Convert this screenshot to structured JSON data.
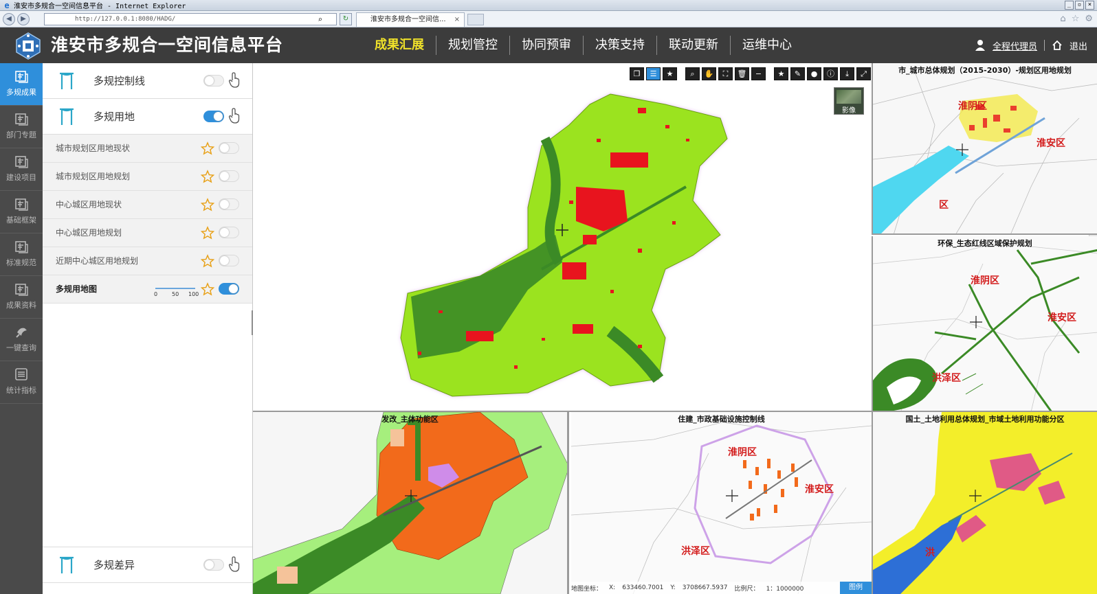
{
  "browser": {
    "window_title": "淮安市多规合一空间信息平台 - Internet Explorer",
    "url": "http://127.0.0.1:8080/HADG/",
    "tab_title": "淮安市多规合一空间信..."
  },
  "header": {
    "title": "淮安市多规合一空间信息平台",
    "nav": [
      {
        "label": "成果汇展",
        "active": true
      },
      {
        "label": "规划管控",
        "active": false
      },
      {
        "label": "协同预审",
        "active": false
      },
      {
        "label": "决策支持",
        "active": false
      },
      {
        "label": "联动更新",
        "active": false
      },
      {
        "label": "运维中心",
        "active": false
      }
    ],
    "user_name": "全程代理员",
    "logout_label": "退出",
    "accent_color": "#f0e22a",
    "bar_color": "#3c3c3c"
  },
  "rail": [
    {
      "label": "多规成果",
      "icon": "layers-icon",
      "active": true
    },
    {
      "label": "部门专题",
      "icon": "layers-icon",
      "active": false
    },
    {
      "label": "建设项目",
      "icon": "layers-icon",
      "active": false
    },
    {
      "label": "基础框架",
      "icon": "layers-icon",
      "active": false
    },
    {
      "label": "标准规范",
      "icon": "layers-icon",
      "active": false
    },
    {
      "label": "成果资料",
      "icon": "layers-icon",
      "active": false
    },
    {
      "label": "一键查询",
      "icon": "pointer-icon",
      "active": false
    },
    {
      "label": "统计指标",
      "icon": "list-icon",
      "active": false
    }
  ],
  "layers": {
    "groups_top": [
      {
        "label": "多规控制线",
        "on": false
      },
      {
        "label": "多规用地",
        "on": true
      }
    ],
    "items": [
      {
        "label": "城市规划区用地现状",
        "on": false
      },
      {
        "label": "城市规划区用地规划",
        "on": false
      },
      {
        "label": "中心城区用地现状",
        "on": false
      },
      {
        "label": "中心城区用地规划",
        "on": false
      },
      {
        "label": "近期中心城区用地规划",
        "on": false
      }
    ],
    "combined": {
      "label": "多规用地图",
      "on": true,
      "opacity_ticks": [
        "0",
        "50",
        "100"
      ]
    },
    "group_bottom": {
      "label": "多规差异",
      "on": false
    }
  },
  "main_map": {
    "imagery_label": "影像",
    "toolbar_icons": [
      "window-icon",
      "list-icon",
      "star-icon",
      "zoom-icon",
      "pan-icon",
      "extent-icon",
      "delete-icon",
      "minus-icon",
      "favorite-icon",
      "eraser-icon",
      "comment-icon",
      "info-icon",
      "download-icon",
      "fullscreen-icon"
    ]
  },
  "panes": {
    "r1": {
      "title": "市_城市总体规划（2015-2030）-规划区用地规划",
      "labels": [
        "淮阴区",
        "淮安区",
        "区"
      ]
    },
    "r2": {
      "title": "环保_生态红线区域保护规划",
      "labels": [
        "淮阴区",
        "淮安区",
        "洪泽区"
      ]
    },
    "b1": {
      "title": "发改_主体功能区"
    },
    "b2": {
      "title": "住建_市政基础设施控制线",
      "labels": [
        "淮阴区",
        "淮安区",
        "洪泽区"
      ]
    },
    "b3": {
      "title": "国土_土地利用总体规划_市域土地利用功能分区",
      "labels": [
        "洪"
      ]
    }
  },
  "status": {
    "coord_label": "地图坐标：",
    "x_label": "X:",
    "x_value": "633460.7001",
    "y_label": "Y:",
    "y_value": "3708667.5937",
    "scale_label": "比例尺：",
    "scale_value": "1：1000000",
    "legend_label": "图例"
  },
  "colors": {
    "active_blue": "#2f8fdb",
    "district_red": "#d31c1c",
    "landuse_green": "#9be31f",
    "ecological_green": "#3b8a26",
    "urban_red": "#e8141e",
    "function_orange": "#f26a1b",
    "landuse_yellow": "#f3ee2a"
  }
}
